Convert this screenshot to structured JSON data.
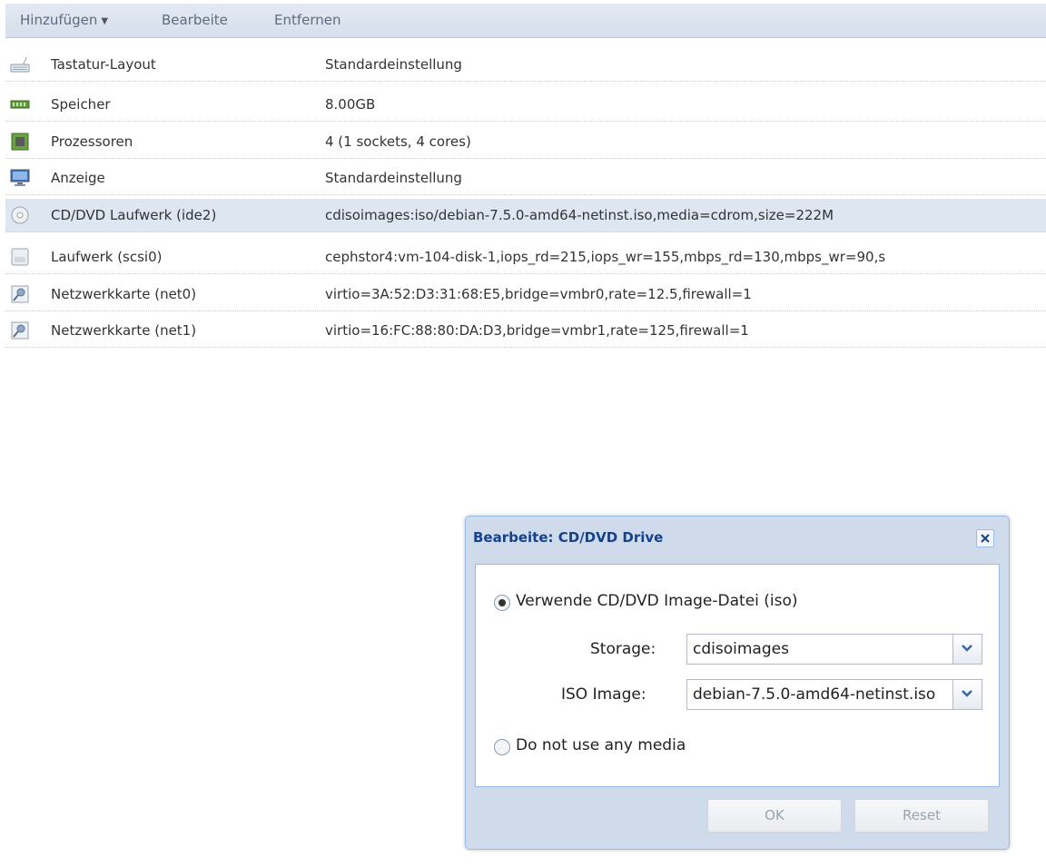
{
  "toolbar": {
    "add_label": "Hinzufügen",
    "edit_label": "Bearbeite",
    "remove_label": "Entfernen"
  },
  "hardware": [
    {
      "icon": "keyboard-icon",
      "name": "Tastatur-Layout",
      "value": "Standardeinstellung"
    },
    {
      "icon": "memory-icon",
      "name": "Speicher",
      "value": "8.00GB"
    },
    {
      "icon": "cpu-icon",
      "name": "Prozessoren",
      "value": "4 (1 sockets, 4 cores)"
    },
    {
      "icon": "monitor-icon",
      "name": "Anzeige",
      "value": "Standardeinstellung"
    },
    {
      "icon": "cdrom-icon",
      "name": "CD/DVD Laufwerk (ide2)",
      "value": "cdisoimages:iso/debian-7.5.0-amd64-netinst.iso,media=cdrom,size=222M",
      "selected": true
    },
    {
      "icon": "harddisk-icon",
      "name": "Laufwerk (scsi0)",
      "value": "cephstor4:vm-104-disk-1,iops_rd=215,iops_wr=155,mbps_rd=130,mbps_wr=90,s"
    },
    {
      "icon": "network-card-icon",
      "name": "Netzwerkkarte (net0)",
      "value": "virtio=3A:52:D3:31:68:E5,bridge=vmbr0,rate=12.5,firewall=1"
    },
    {
      "icon": "network-card-icon",
      "name": "Netzwerkkarte (net1)",
      "value": "virtio=16:FC:88:80:DA:D3,bridge=vmbr1,rate=125,firewall=1"
    }
  ],
  "dialog": {
    "title": "Bearbeite: CD/DVD Drive",
    "option_iso": "Verwende CD/DVD Image-Datei (iso)",
    "option_iso_checked": true,
    "storage_label": "Storage:",
    "storage_value": "cdisoimages",
    "iso_label": "ISO Image:",
    "iso_value": "debian-7.5.0-amd64-netinst.iso",
    "option_none": "Do not use any media",
    "option_none_checked": false,
    "ok_label": "OK",
    "reset_label": "Reset"
  },
  "colors": {
    "dialog_title": "#15428b",
    "selected_row": "#dde6f1",
    "dialog_border": "#99bbe8"
  }
}
